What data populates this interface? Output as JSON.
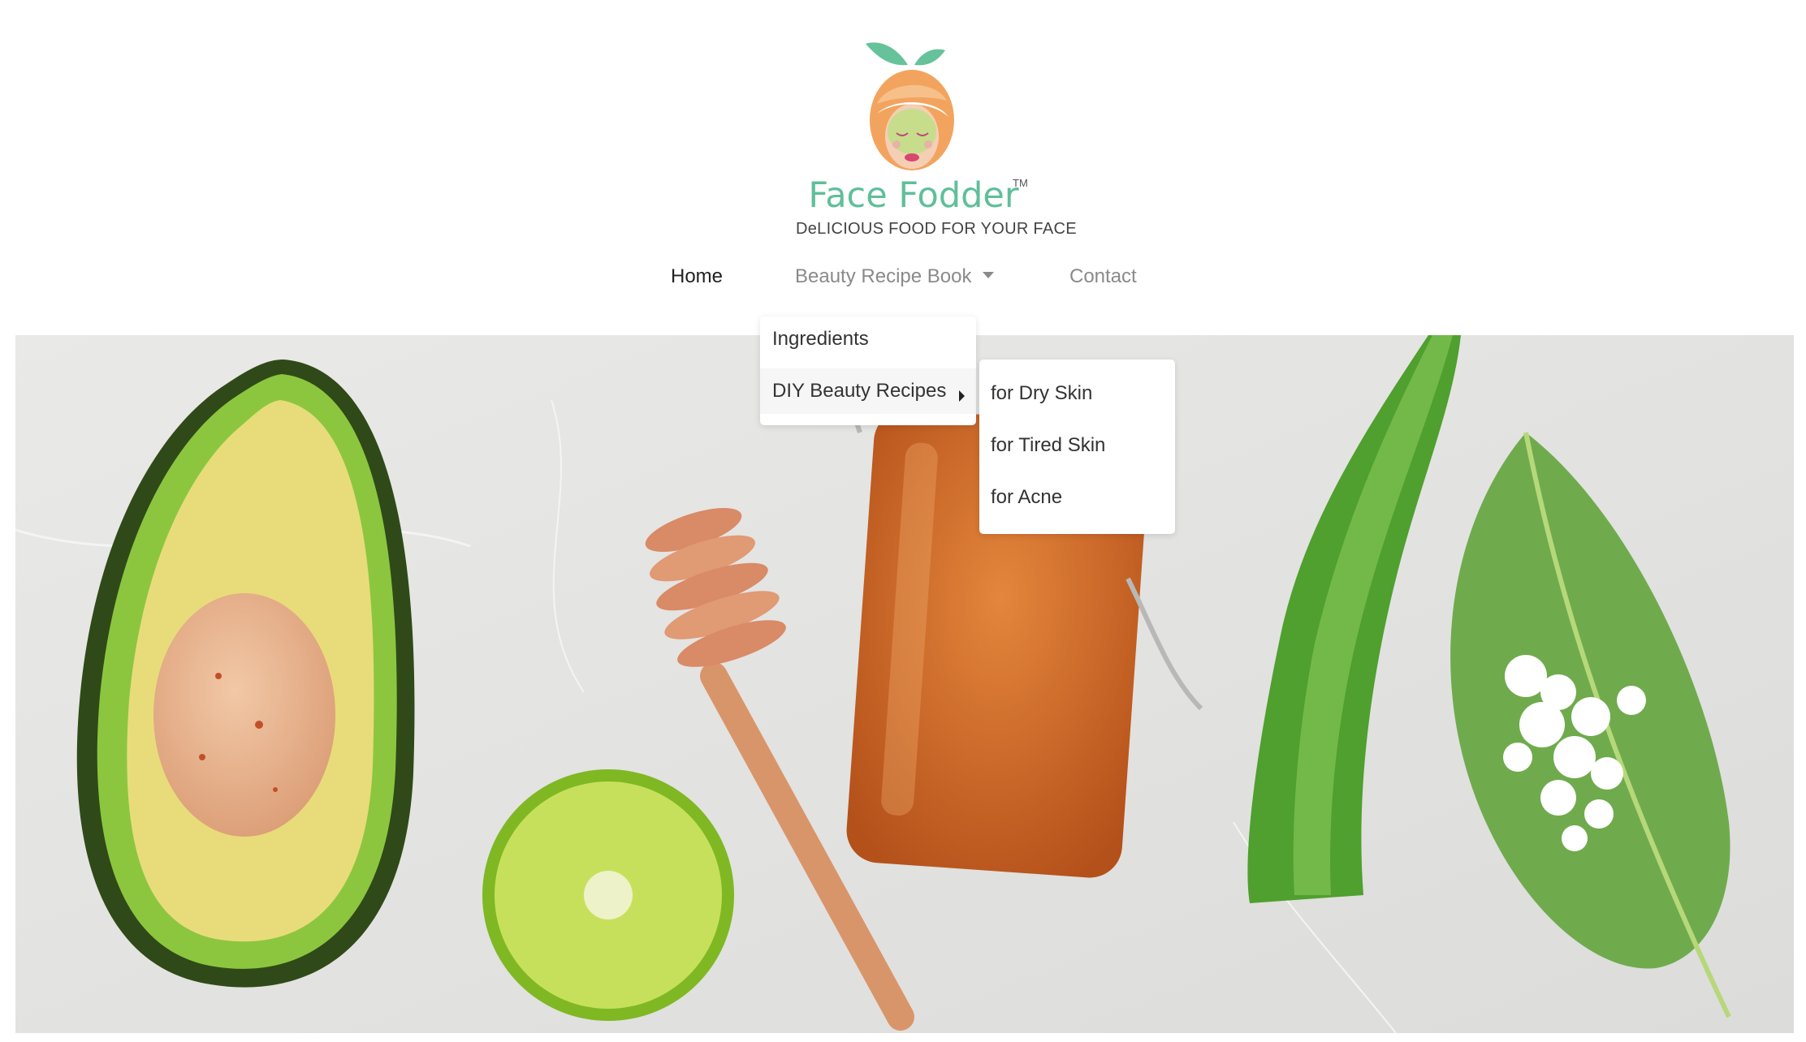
{
  "logo": {
    "brand_name": "Face Fodder",
    "trademark": "TM",
    "tagline": "DeLICIOUS FOOD FOR YOUR FACE"
  },
  "nav": {
    "home": "Home",
    "recipe_book": "Beauty Recipe Book",
    "contact": "Contact"
  },
  "dropdown": {
    "ingredients": "Ingredients",
    "diy_recipes": "DIY Beauty Recipes"
  },
  "submenu": {
    "dry_skin": "for Dry Skin",
    "tired_skin": "for Tired Skin",
    "acne": "for Acne"
  },
  "hero": {
    "image": "avocado-honey-lime-aloe-leaf-salt-photo"
  },
  "colors": {
    "brand_green": "#5fbf9a",
    "logo_orange": "#f2a66a",
    "nav_inactive": "#8a8a8a",
    "nav_active": "#222222"
  }
}
